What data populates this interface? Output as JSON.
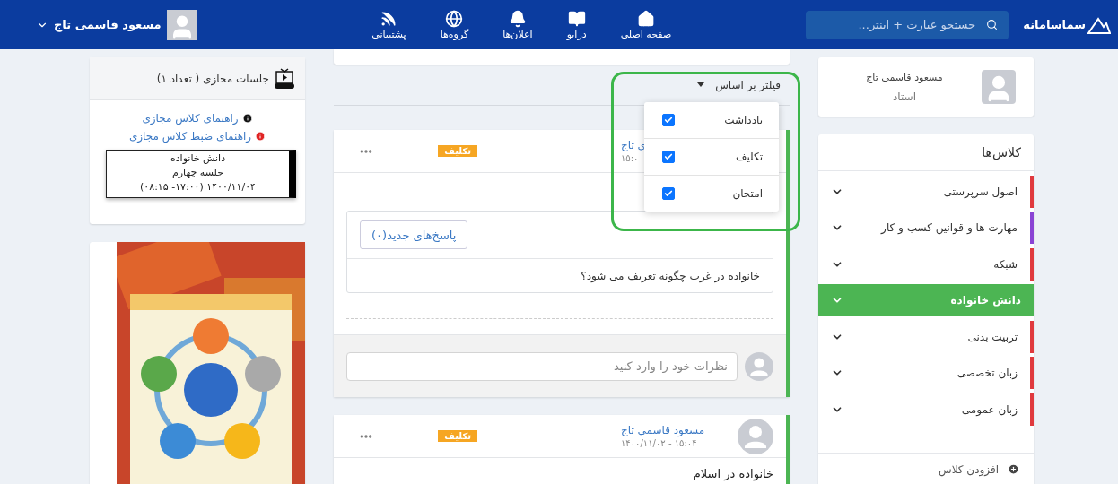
{
  "header": {
    "logo": "سماسامانه",
    "search": {
      "placeholder": "جستجو عبارت + اینتر..."
    },
    "nav": [
      {
        "label": "صفحه اصلی",
        "kind": "home"
      },
      {
        "label": "درایو",
        "kind": "drive"
      },
      {
        "label": "اعلان‌ها",
        "kind": "bell"
      },
      {
        "label": "گروه‌ها",
        "kind": "globe"
      },
      {
        "label": "پشتیبانی",
        "kind": "rss"
      }
    ],
    "user": {
      "name": "مسعود قاسمی تاج"
    }
  },
  "profile": {
    "name": "مسعود قاسمی تاج",
    "role": "استاد"
  },
  "classes": {
    "title": "کلاس‌ها",
    "items": [
      {
        "name": "اصول سرپرستی",
        "color": "#e03a3e",
        "selected": false
      },
      {
        "name": "مهارت ها و قوانین کسب و کار",
        "color": "#8a44d4",
        "selected": false
      },
      {
        "name": "شبکه",
        "color": "#e03a3e",
        "selected": false
      },
      {
        "name": "دانش خانواده",
        "color": "#4cb553",
        "selected": true
      },
      {
        "name": "تربیت بدنی",
        "color": "#e03a3e",
        "selected": false
      },
      {
        "name": "زبان تخصصی",
        "color": "#e03a3e",
        "selected": false
      },
      {
        "name": "زبان عمومی",
        "color": "#e03a3e",
        "selected": false
      }
    ],
    "add": "افزودن کلاس"
  },
  "filter": {
    "label": "فیلتر بر اساس",
    "options": [
      {
        "label": "یادداشت",
        "checked": true
      },
      {
        "label": "تکلیف",
        "checked": true
      },
      {
        "label": "امتحان",
        "checked": true
      }
    ]
  },
  "posts": [
    {
      "avatar": false,
      "author": "ی تاج",
      "date": "۱۵:۰",
      "badge": "تکلیف",
      "attachment": {
        "button": "پاسخ‌های جدید(۰)",
        "question": "خانواده در غرب چگونه تعریف می شود؟"
      },
      "comment": {
        "placeholder": "نظرات خود را وارد کنید"
      }
    },
    {
      "avatar": true,
      "author": "مسعود قاسمی تاج",
      "date": "۱۵:۰۴ - ۱۴۰۰/۱۱/۰۲",
      "badge": "تکلیف",
      "body": "خانواده در اسلام"
    }
  ],
  "sessions": {
    "title": "جلسات مجازی ( تعداد ۱)",
    "links": [
      {
        "label": "راهنمای کلاس مجازی",
        "color": "#111111"
      },
      {
        "label": "راهنمای ضبط کلاس مجازی",
        "color": "#e02424"
      }
    ],
    "session": {
      "lines": [
        "دانش خانواده",
        "جلسه چهارم",
        "۱۴۰۰/۱۱/۰۴ (۱۷:۰۰- ۰۸:۱۵)"
      ]
    }
  }
}
